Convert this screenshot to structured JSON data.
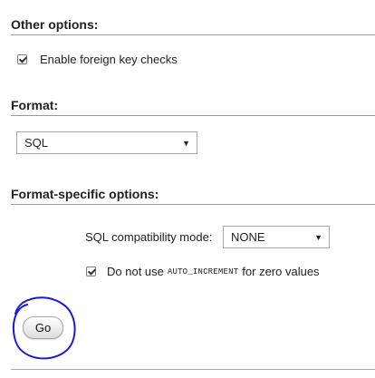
{
  "other_options": {
    "title": "Other options:",
    "foreign_key_checks_label": "Enable foreign key checks",
    "foreign_key_checks_checked": true
  },
  "format": {
    "title": "Format:",
    "selected": "SQL"
  },
  "format_specific": {
    "title": "Format-specific options:",
    "sql_compat_label": "SQL compatibility mode:",
    "sql_compat_value": "NONE",
    "auto_increment_prefix": "Do not use",
    "auto_increment_code": "AUTO_INCREMENT",
    "auto_increment_suffix": "for zero values",
    "auto_increment_checked": true
  },
  "actions": {
    "go_label": "Go"
  },
  "annotation": {
    "circle_color": "#1a1adb"
  }
}
